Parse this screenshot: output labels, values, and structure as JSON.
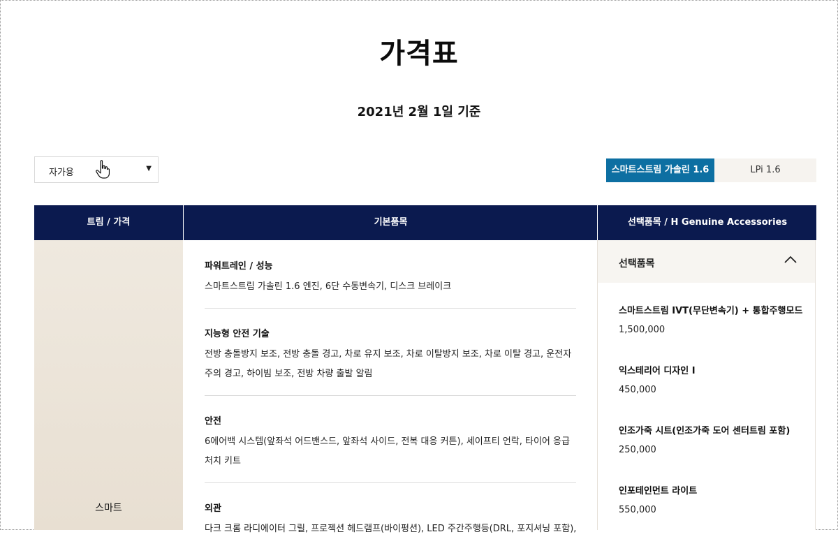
{
  "page": {
    "title": "가격표",
    "date": "2021년 2월 1일 기준"
  },
  "filter": {
    "selected": "자가용",
    "arrow": "▼"
  },
  "engine_tabs": [
    {
      "label": "스마트스트림 가솔린 1.6",
      "active": true
    },
    {
      "label": "LPi 1.6",
      "active": false
    }
  ],
  "table": {
    "headers": [
      "트림 / 가격",
      "기본품목",
      "선택품목 / H Genuine Accessories"
    ],
    "trim": "스마트",
    "basic_items": [
      {
        "title": "파워트레인 / 성능",
        "desc": "스마트스트림 가솔린 1.6 엔진, 6단 수동변속기, 디스크 브레이크"
      },
      {
        "title": "지능형 안전 기술",
        "desc": "전방 충돌방지 보조, 전방 충돌 경고, 차로 유지 보조, 차로 이탈방지 보조, 차로 이탈 경고, 운전자 주의 경고, 하이빔 보조, 전방 차량 출발 알림"
      },
      {
        "title": "안전",
        "desc": "6에어백 시스템(앞좌석 어드밴스드, 앞좌석 사이드, 전복 대응 커튼), 세이프티 언락, 타이어 응급처치 키트"
      },
      {
        "title": "외관",
        "desc": "다크 크롬 라디에이터 그릴, 프로젝션 헤드램프(바이펑션), LED 주간주행등(DRL, 포지셔닝 포함), 멀티"
      }
    ],
    "options": {
      "header": "선택품목",
      "items": [
        {
          "name": "스마트스트림 IVT(무단변속기) + 통합주행모드",
          "price": "1,500,000"
        },
        {
          "name": "익스테리어 디자인 I",
          "price": "450,000"
        },
        {
          "name": "인조가죽 시트(인조가죽 도어 센터트림 포함)",
          "price": "250,000"
        },
        {
          "name": "인포테인먼트 라이트",
          "price": "550,000"
        }
      ]
    }
  },
  "colors": {
    "header_bg": "#0b1a4f",
    "active_tab": "#0d6fa2",
    "trim_bg": "#e8dfd2"
  }
}
